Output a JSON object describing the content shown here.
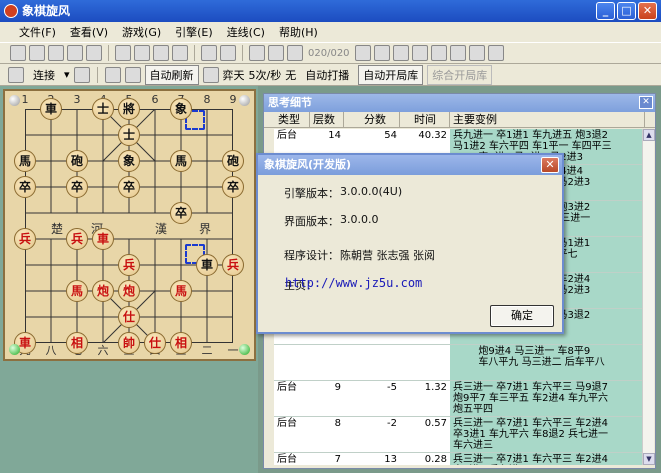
{
  "window": {
    "title": "象棋旋风",
    "min": "_",
    "max": "□",
    "close": "✕"
  },
  "menu": [
    "文件(F)",
    "查看(V)",
    "游戏(G)",
    "引擎(E)",
    "连线(C)",
    "帮助(H)"
  ],
  "toolbar1": {
    "counter": "020/020"
  },
  "toolbar2": {
    "connect": "连接",
    "auto_refresh": "自动刷新",
    "opponent": "弈天",
    "speed": "5次/秒",
    "none": "无",
    "auto_tap": "自动打播",
    "auto_open_lib": "自动开局库",
    "combine_lib": "综合开局库"
  },
  "board": {
    "top_files": [
      "1",
      "2",
      "3",
      "4",
      "5",
      "6",
      "7",
      "8",
      "9"
    ],
    "bottom_files": [
      "九",
      "八",
      "七",
      "六",
      "五",
      "四",
      "三",
      "二",
      "一"
    ],
    "river_left": [
      "楚",
      "河"
    ],
    "river_right": [
      "漢",
      "界"
    ],
    "pieces": [
      {
        "t": "車",
        "side": "black",
        "f": 1,
        "r": 0
      },
      {
        "t": "士",
        "side": "black",
        "f": 3,
        "r": 0
      },
      {
        "t": "將",
        "side": "black",
        "f": 4,
        "r": 0
      },
      {
        "t": "象",
        "side": "black",
        "f": 6,
        "r": 0
      },
      {
        "t": "士",
        "side": "black",
        "f": 4,
        "r": 1
      },
      {
        "t": "馬",
        "side": "black",
        "f": 0,
        "r": 2
      },
      {
        "t": "砲",
        "side": "black",
        "f": 2,
        "r": 2
      },
      {
        "t": "象",
        "side": "black",
        "f": 4,
        "r": 2
      },
      {
        "t": "馬",
        "side": "black",
        "f": 6,
        "r": 2
      },
      {
        "t": "砲",
        "side": "black",
        "f": 8,
        "r": 2
      },
      {
        "t": "卒",
        "side": "black",
        "f": 0,
        "r": 3
      },
      {
        "t": "卒",
        "side": "black",
        "f": 2,
        "r": 3
      },
      {
        "t": "卒",
        "side": "black",
        "f": 4,
        "r": 3
      },
      {
        "t": "卒",
        "side": "black",
        "f": 8,
        "r": 3
      },
      {
        "t": "卒",
        "side": "black",
        "f": 6,
        "r": 4
      },
      {
        "t": "兵",
        "side": "red",
        "f": 0,
        "r": 5
      },
      {
        "t": "兵",
        "side": "red",
        "f": 2,
        "r": 5
      },
      {
        "t": "車",
        "side": "red",
        "f": 3,
        "r": 5
      },
      {
        "t": "兵",
        "side": "red",
        "f": 4,
        "r": 6
      },
      {
        "t": "車",
        "side": "black",
        "f": 7,
        "r": 6
      },
      {
        "t": "兵",
        "side": "red",
        "f": 8,
        "r": 6
      },
      {
        "t": "馬",
        "side": "red",
        "f": 2,
        "r": 7
      },
      {
        "t": "炮",
        "side": "red",
        "f": 3,
        "r": 7
      },
      {
        "t": "炮",
        "side": "red",
        "f": 4,
        "r": 7
      },
      {
        "t": "馬",
        "side": "red",
        "f": 6,
        "r": 7
      },
      {
        "t": "仕",
        "side": "red",
        "f": 4,
        "r": 8
      },
      {
        "t": "車",
        "side": "red",
        "f": 0,
        "r": 9
      },
      {
        "t": "相",
        "side": "red",
        "f": 2,
        "r": 9
      },
      {
        "t": "帥",
        "side": "red",
        "f": 4,
        "r": 9
      },
      {
        "t": "仕",
        "side": "red",
        "f": 5,
        "r": 9
      },
      {
        "t": "相",
        "side": "red",
        "f": 6,
        "r": 9
      }
    ]
  },
  "detail": {
    "title": "思考细节",
    "headers": [
      "类型",
      "层数",
      "分数",
      "时间",
      "主要变例"
    ],
    "rows": [
      {
        "type": "后台",
        "depth": "14",
        "score": "54",
        "time": "40.32",
        "var": "兵九进一 卒1进1 车九进五 炮3退2\n马1进2 车六平四 车1平一 车四平三\n        卒1进1 马1进1 马2进3"
      },
      {
        "type": "",
        "depth": "",
        "score": "",
        "time": "",
        "var": "        车1进1 马1进1 车4进4\n        马3退2 车六进三 马2进3"
      },
      {
        "type": "",
        "depth": "",
        "score": "",
        "time": "",
        "var": "        卒9进1 车四平一 炮3进2\n        炮2进1 卒3进1 兵三进一"
      },
      {
        "type": "",
        "depth": "",
        "score": "",
        "time": "",
        "var": "        车九平一 车2退2 马1进1\n        卒4平4 车九进一 平七"
      },
      {
        "type": "",
        "depth": "",
        "score": "",
        "time": "",
        "var": "        车三进一 卒2平2 车2进4\n        车3进3 车六退三 马2进3"
      },
      {
        "type": "",
        "depth": "",
        "score": "",
        "time": "",
        "var": "        车六平四 马1进1 马3退2\n        车四平六 车1平2"
      },
      {
        "type": "",
        "depth": "",
        "score": "",
        "time": "",
        "var": "        炮9进4 马三进一 车8平9\n        车八平九 马三进二 后车平八"
      },
      {
        "type": "后台",
        "depth": "9",
        "score": "-5",
        "time": "1.32",
        "var": "兵三进一 卒7进1 车六平三 马9退7\n炮9平7 车三平五 车2进4 车九平六\n炮五平四"
      },
      {
        "type": "后台",
        "depth": "8",
        "score": "-2",
        "time": "0.57",
        "var": "兵三进一 卒7进1 车六平三 车2进4\n卒3进1 车九平六 车8退2 兵七进一\n车六进三"
      },
      {
        "type": "后台",
        "depth": "7",
        "score": "13",
        "time": "0.28",
        "var": "兵三进一 卒7进1 车六平三 车2进4\n卒3进1 兵七进一"
      }
    ]
  },
  "about": {
    "title": "象棋旋风(开发版)",
    "engine_label": "引擎版本：",
    "engine_value": "3.0.0.0(4U)",
    "ui_label": "界面版本：",
    "ui_value": "3.0.0.0",
    "design_label": "程序设计：",
    "designers": "陈朝营  张志强  张阅",
    "home_label": "主页：",
    "home_link": "http://www.jz5u.com",
    "ok": "确定"
  }
}
